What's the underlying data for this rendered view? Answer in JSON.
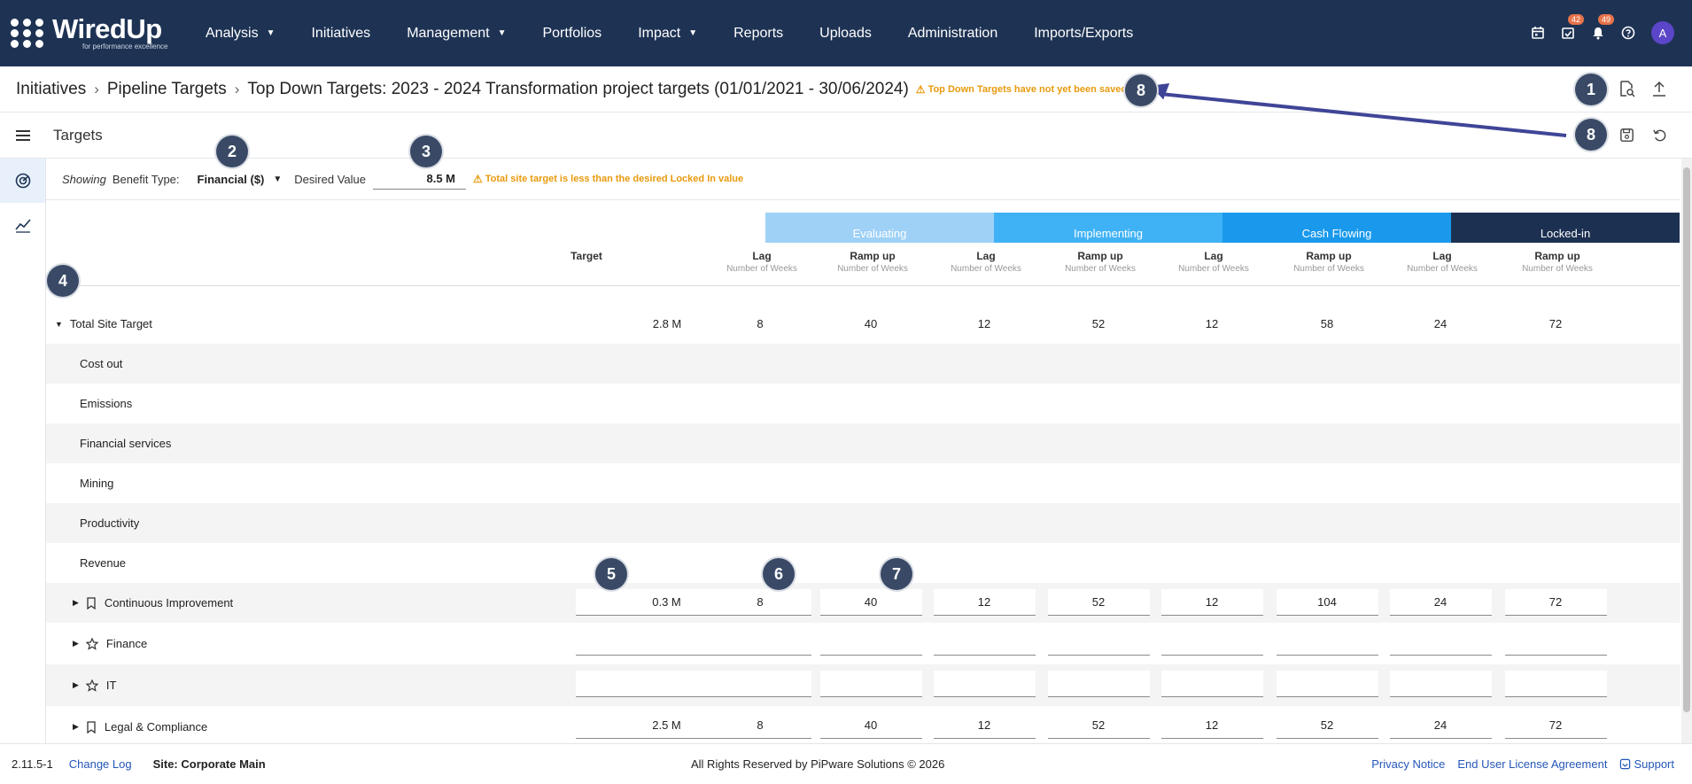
{
  "nav": {
    "logo_main": "WiredUp",
    "logo_sub": "for performance excellence",
    "items": [
      {
        "label": "Analysis",
        "dropdown": true
      },
      {
        "label": "Initiatives",
        "dropdown": false
      },
      {
        "label": "Management",
        "dropdown": true
      },
      {
        "label": "Portfolios",
        "dropdown": false
      },
      {
        "label": "Impact",
        "dropdown": true
      },
      {
        "label": "Reports",
        "dropdown": false
      },
      {
        "label": "Uploads",
        "dropdown": false
      },
      {
        "label": "Administration",
        "dropdown": false
      },
      {
        "label": "Imports/Exports",
        "dropdown": false
      }
    ],
    "tasks_badge": "42",
    "notifications_badge": "49",
    "avatar": "A"
  },
  "breadcrumb": {
    "items": [
      "Initiatives",
      "Pipeline Targets",
      "Top Down Targets: 2023 - 2024 Transformation project targets (01/01/2021 - 30/06/2024)"
    ],
    "warning": "Top Down Targets have not yet been saved"
  },
  "targets_title": "Targets",
  "filter": {
    "showing": "Showing",
    "benefit_label": "Benefit Type:",
    "benefit_value": "Financial ($)",
    "desired_label": "Desired Value",
    "desired_value": "8.5 M",
    "warning": "Total site target is less than the desired Locked In value"
  },
  "markers": [
    "1",
    "2",
    "3",
    "4",
    "5",
    "6",
    "7",
    "8",
    "8"
  ],
  "table": {
    "target_header": "Target",
    "phases": [
      {
        "name": "Evaluating",
        "color": "#9fd1f7"
      },
      {
        "name": "Implementing",
        "color": "#3fb2f5"
      },
      {
        "name": "Cash Flowing",
        "color": "#1a99ec"
      },
      {
        "name": "Locked-in",
        "color": "#1c3152"
      }
    ],
    "lag_label": "Lag",
    "ramp_label": "Ramp up",
    "weeks_label": "Number of Weeks",
    "total_row": {
      "label": "Total Site Target",
      "target": "2.8 M",
      "values": [
        "8",
        "40",
        "12",
        "52",
        "12",
        "58",
        "24",
        "72"
      ]
    },
    "benefit_rows": [
      "Cost out",
      "Emissions",
      "Financial services",
      "Mining",
      "Productivity",
      "Revenue"
    ],
    "portfolio_rows": [
      {
        "label": "Continuous Improvement",
        "icon": "bookmark",
        "target": "0.3 M",
        "values": [
          "8",
          "40",
          "12",
          "52",
          "12",
          "104",
          "24",
          "72"
        ]
      },
      {
        "label": "Finance",
        "icon": "star",
        "target": "",
        "values": [
          "",
          "",
          "",
          "",
          "",
          "",
          "",
          ""
        ]
      },
      {
        "label": "IT",
        "icon": "star",
        "target": "",
        "values": [
          "",
          "",
          "",
          "",
          "",
          "",
          "",
          ""
        ]
      },
      {
        "label": "Legal & Compliance",
        "icon": "bookmark",
        "target": "2.5 M",
        "values": [
          "8",
          "40",
          "12",
          "52",
          "12",
          "52",
          "24",
          "72"
        ]
      }
    ]
  },
  "footer": {
    "version": "2.11.5-1",
    "changelog": "Change Log",
    "site": "Site: Corporate Main",
    "copyright": "All Rights Reserved by PiPware Solutions © 2026",
    "privacy": "Privacy Notice",
    "eula": "End User License Agreement",
    "support": "Support"
  }
}
